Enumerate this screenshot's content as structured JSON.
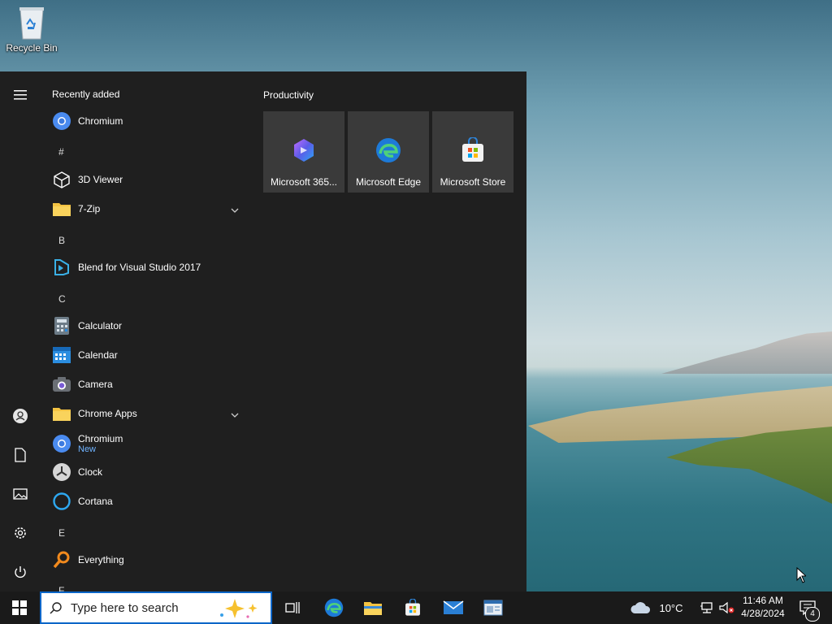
{
  "desktop": {
    "recycle_bin_label": "Recycle Bin"
  },
  "start_menu": {
    "recently_added_title": "Recently added",
    "recent_app": "Chromium",
    "sections": {
      "hash": "#",
      "b": "B",
      "c": "C",
      "e": "E",
      "f_partial": "F"
    },
    "apps": {
      "viewer_3d": "3D Viewer",
      "zip": "7-Zip",
      "blend": "Blend for Visual Studio 2017",
      "calculator": "Calculator",
      "calendar": "Calendar",
      "camera": "Camera",
      "chrome_apps": "Chrome Apps",
      "chromium": "Chromium",
      "chromium_badge": "New",
      "clock": "Clock",
      "cortana": "Cortana",
      "everything": "Everything"
    },
    "tiles_title": "Productivity",
    "tiles": [
      "Microsoft 365...",
      "Microsoft Edge",
      "Microsoft Store"
    ]
  },
  "taskbar": {
    "search_placeholder": "Type here to search",
    "weather_temp": "10°C",
    "time": "11:46 AM",
    "date": "4/28/2024",
    "notification_count": "4"
  },
  "colors": {
    "accent": "#0a66c8",
    "menu_bg": "#1f1f1f",
    "tile_bg": "#3a3a3a",
    "taskbar_bg": "#1a1a1a"
  }
}
